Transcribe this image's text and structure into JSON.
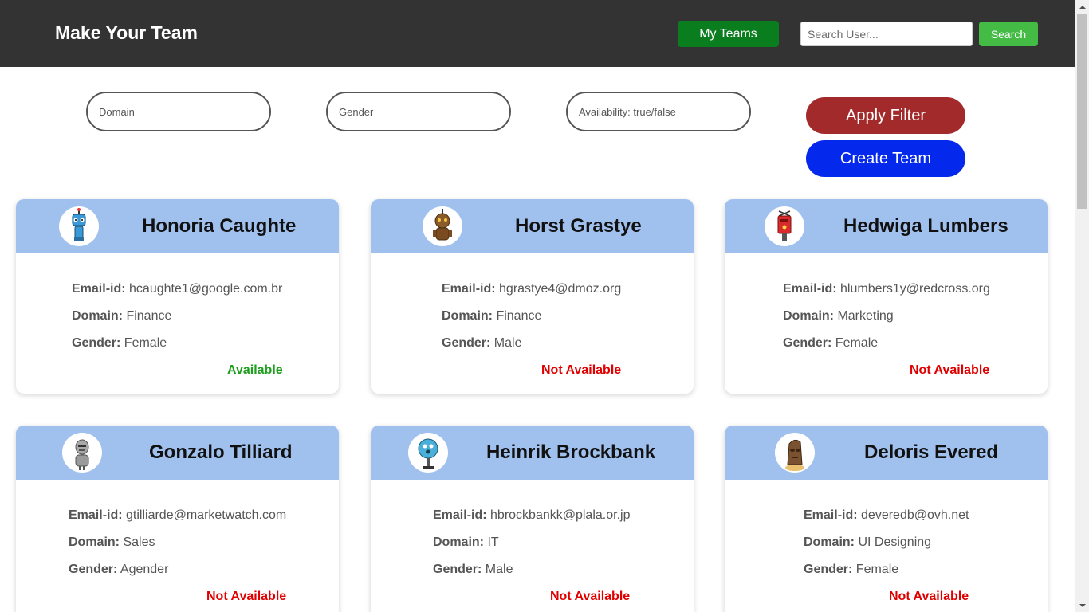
{
  "header": {
    "brand": "Make Your Team",
    "my_teams_label": "My Teams",
    "search_placeholder": "Search User...",
    "search_label": "Search"
  },
  "filters": {
    "domain_placeholder": "Domain",
    "gender_placeholder": "Gender",
    "availability_placeholder": "Availability: true/false",
    "apply_label": "Apply Filter",
    "create_label": "Create Team"
  },
  "labels": {
    "email": "Email-id:",
    "domain": "Domain:",
    "gender": "Gender:"
  },
  "colors": {
    "available": "#1e9e1e",
    "not_available": "#e00000"
  },
  "users": [
    {
      "name": "Honoria Caughte",
      "email": "hcaughte1@google.com.br",
      "domain": "Finance",
      "gender": "Female",
      "status": "Available",
      "available": true,
      "avatar": "blue-robot-icon"
    },
    {
      "name": "Horst Grastye",
      "email": "hgrastye4@dmoz.org",
      "domain": "Finance",
      "gender": "Male",
      "status": "Not Available",
      "available": false,
      "avatar": "brown-robot-icon"
    },
    {
      "name": "Hedwiga Lumbers",
      "email": "hlumbers1y@redcross.org",
      "domain": "Marketing",
      "gender": "Female",
      "status": "Not Available",
      "available": false,
      "avatar": "red-robot-icon"
    },
    {
      "name": "Gonzalo Tilliard",
      "email": "gtilliarde@marketwatch.com",
      "domain": "Sales",
      "gender": "Agender",
      "status": "Not Available",
      "available": false,
      "avatar": "gray-robot-icon"
    },
    {
      "name": "Heinrik Brockbank",
      "email": "hbrockbankk@plala.or.jp",
      "domain": "IT",
      "gender": "Male",
      "status": "Not Available",
      "available": false,
      "avatar": "teal-robot-icon"
    },
    {
      "name": "Deloris Evered",
      "email": "deveredb@ovh.net",
      "domain": "UI Designing",
      "gender": "Female",
      "status": "Not Available",
      "available": false,
      "avatar": "brown-head-robot-icon"
    }
  ]
}
